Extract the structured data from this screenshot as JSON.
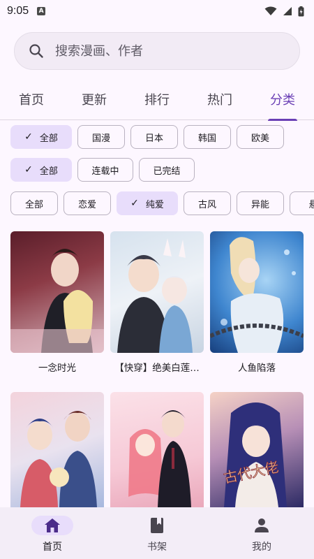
{
  "status": {
    "time": "9:05"
  },
  "search": {
    "placeholder": "搜索漫画、作者"
  },
  "tabs": [
    {
      "label": "首页"
    },
    {
      "label": "更新"
    },
    {
      "label": "排行"
    },
    {
      "label": "热门"
    },
    {
      "label": "分类",
      "active": true
    }
  ],
  "filters": {
    "region": [
      "全部",
      "国漫",
      "日本",
      "韩国",
      "欧美"
    ],
    "status": [
      "全部",
      "连载中",
      "已完结"
    ],
    "genre": [
      "全部",
      "恋爱",
      "纯爱",
      "古风",
      "异能",
      "悬"
    ]
  },
  "selected": {
    "region": "全部",
    "status": "全部",
    "genre": "纯爱"
  },
  "comics": [
    {
      "title": "一念时光",
      "cover_colors": [
        "#5a1e2a",
        "#d9b9c2"
      ]
    },
    {
      "title": "【快穿】绝美白莲…",
      "cover_colors": [
        "#2a2d3a",
        "#d6e2ee"
      ]
    },
    {
      "title": "人鱼陷落",
      "cover_colors": [
        "#1f5fa8",
        "#a8d4f5"
      ]
    },
    {
      "title": "",
      "cover_colors": [
        "#3a4f8a",
        "#f3d3dc"
      ]
    },
    {
      "title": "",
      "cover_colors": [
        "#f6c9d6",
        "#8a2a3c"
      ]
    },
    {
      "title": "",
      "cover_colors": [
        "#2c2a64",
        "#f5d2c6"
      ]
    }
  ],
  "bottom_nav": [
    {
      "label": "首页",
      "icon": "home-icon",
      "active": true
    },
    {
      "label": "书架",
      "icon": "bookshelf-icon"
    },
    {
      "label": "我的",
      "icon": "person-icon"
    }
  ],
  "colors": {
    "accent": "#6a3fb5",
    "chip_selected": "#e8ddfb",
    "background": "#fdf7ff"
  }
}
